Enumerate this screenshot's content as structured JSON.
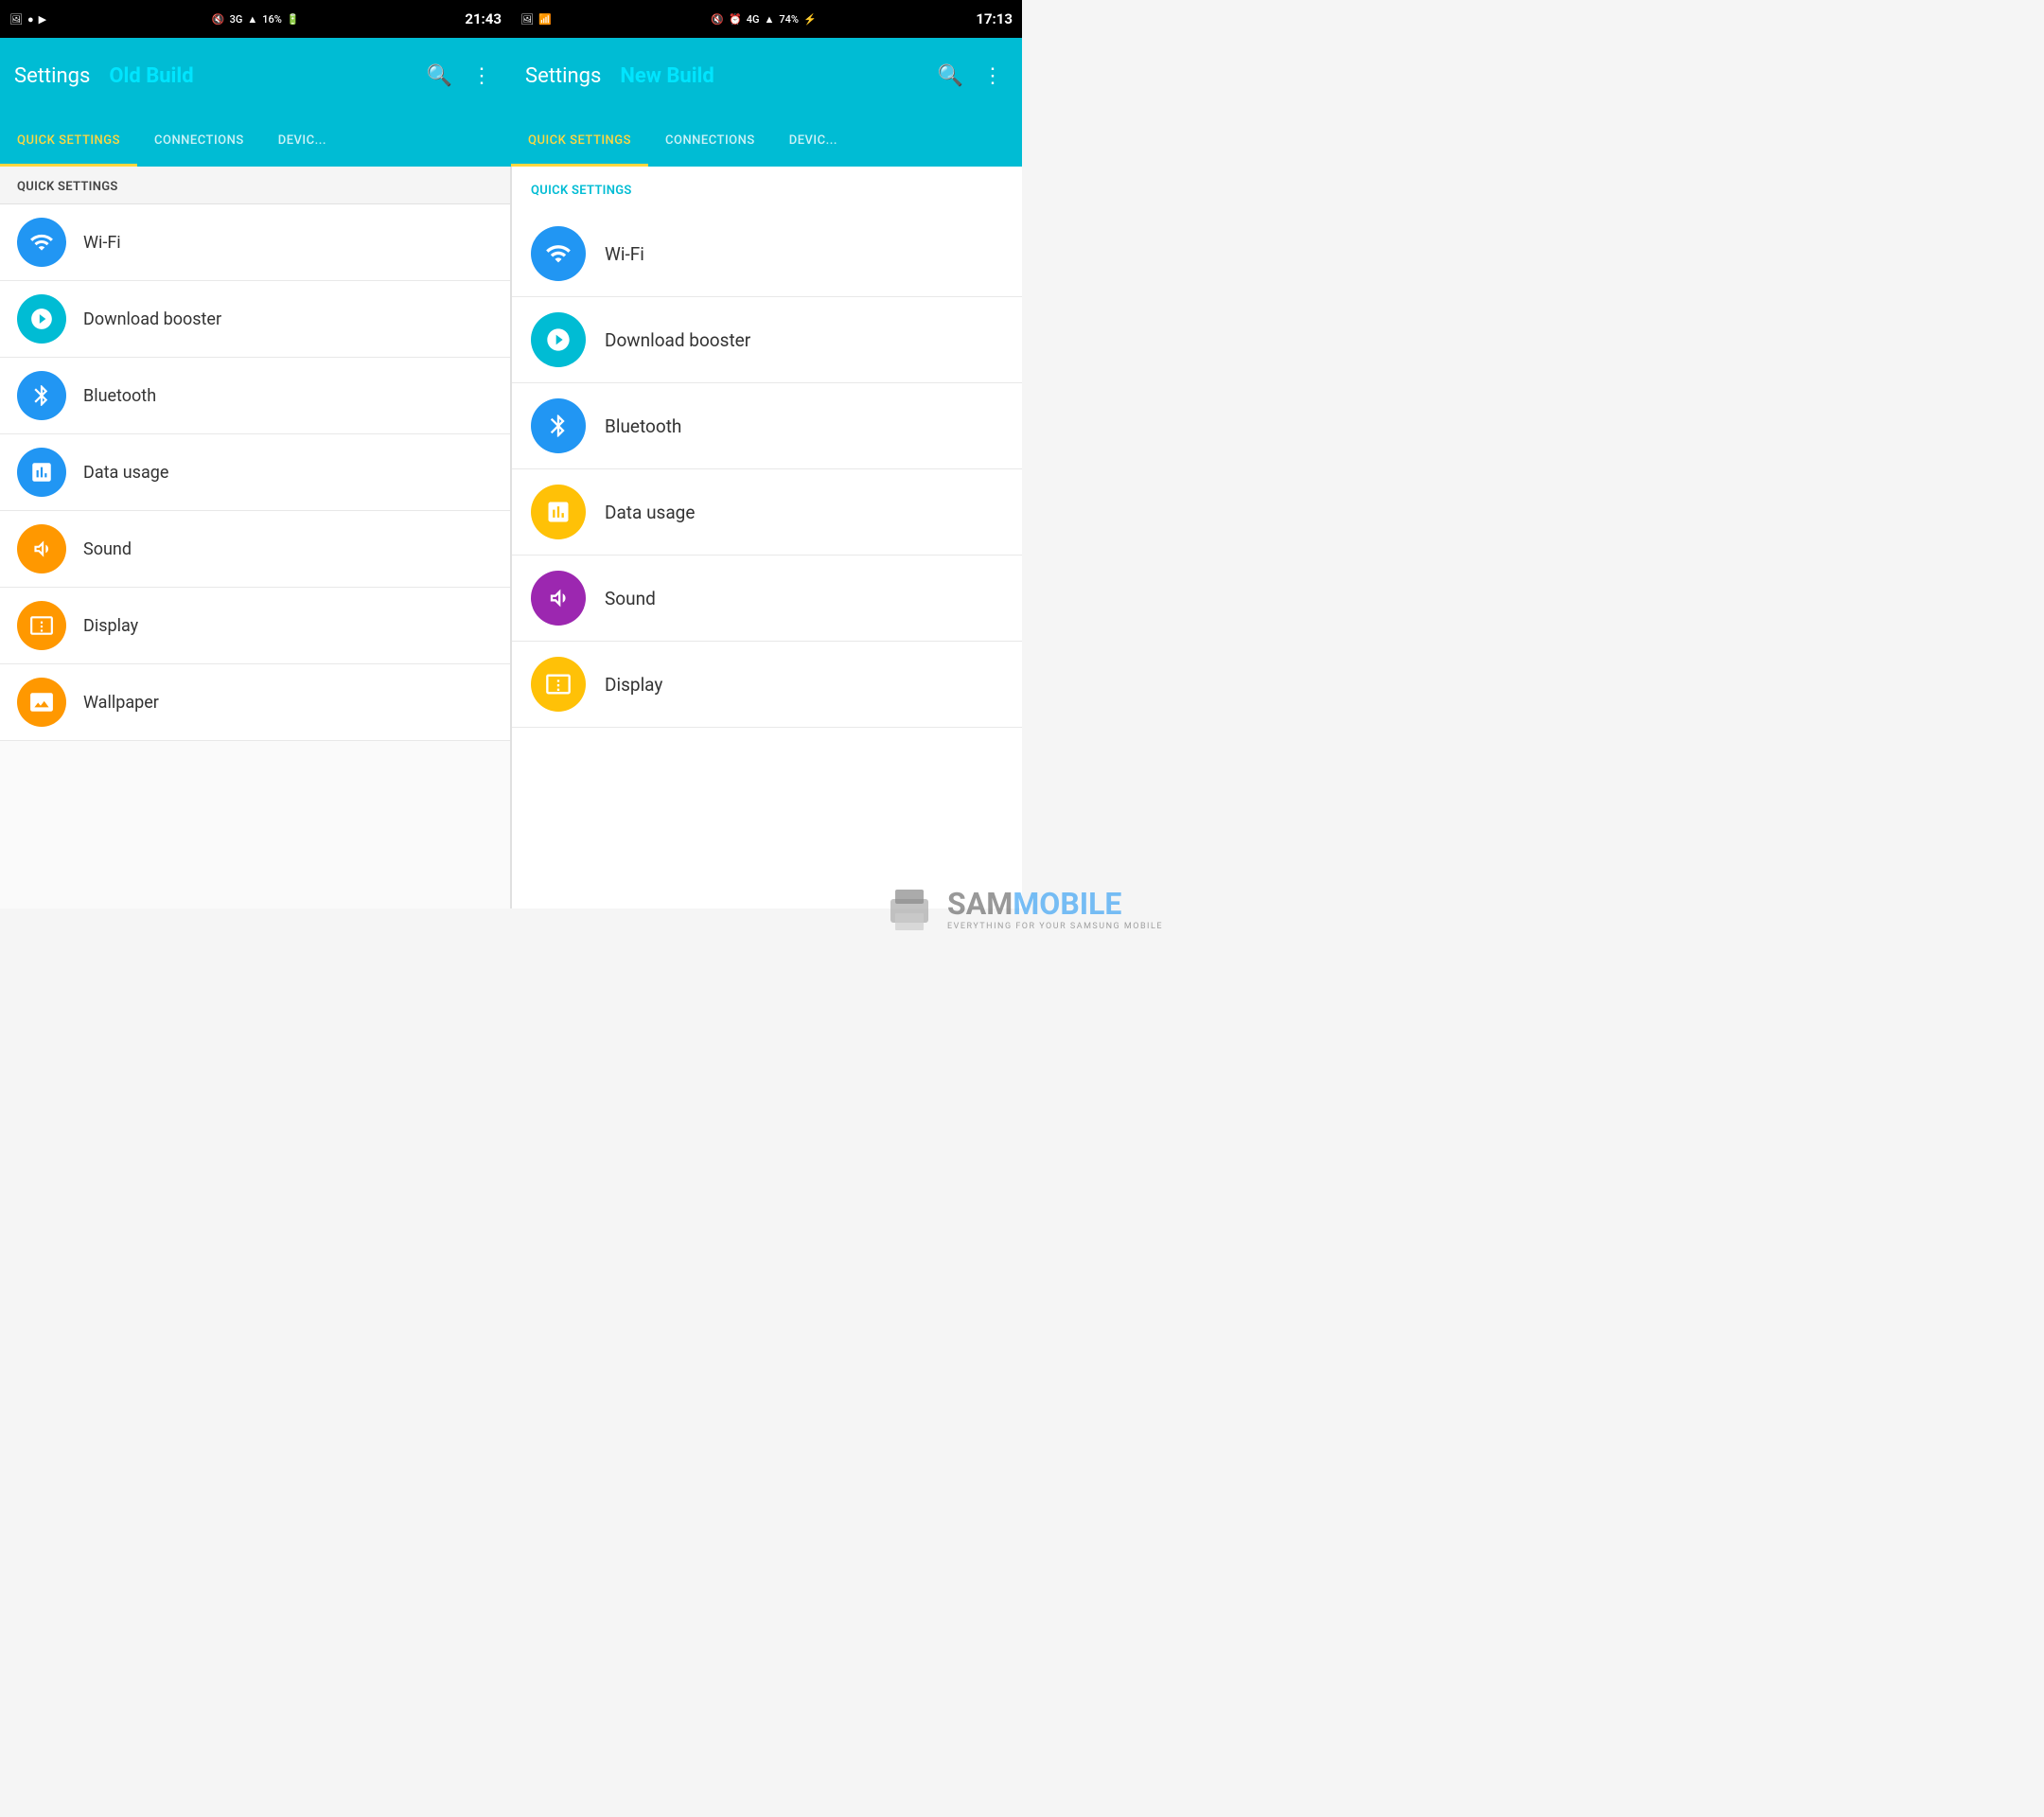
{
  "left": {
    "statusBar": {
      "time": "21:43",
      "battery": "16%",
      "network": "3G"
    },
    "header": {
      "title": "Settings",
      "build": "Old Build"
    },
    "tabs": [
      {
        "label": "QUICK SETTINGS",
        "active": true
      },
      {
        "label": "CONNECTIONS",
        "active": false
      },
      {
        "label": "DEVIC...",
        "active": false
      }
    ],
    "sectionHeader": "QUICK SETTINGS",
    "items": [
      {
        "label": "Wi-Fi",
        "iconColor": "icon-blue",
        "icon": "wifi"
      },
      {
        "label": "Download booster",
        "iconColor": "icon-cyan",
        "icon": "download-booster"
      },
      {
        "label": "Bluetooth",
        "iconColor": "icon-blue",
        "icon": "bluetooth"
      },
      {
        "label": "Data usage",
        "iconColor": "icon-blue",
        "icon": "data-usage"
      },
      {
        "label": "Sound",
        "iconColor": "icon-orange",
        "icon": "sound"
      },
      {
        "label": "Display",
        "iconColor": "icon-orange",
        "icon": "display"
      },
      {
        "label": "Wallpaper",
        "iconColor": "icon-orange",
        "icon": "wallpaper"
      }
    ]
  },
  "right": {
    "statusBar": {
      "time": "17:13",
      "battery": "74%",
      "network": "4G"
    },
    "header": {
      "title": "Settings",
      "build": "New Build"
    },
    "tabs": [
      {
        "label": "QUICK SETTINGS",
        "active": true
      },
      {
        "label": "CONNECTIONS",
        "active": false
      },
      {
        "label": "DEVIC...",
        "active": false
      }
    ],
    "sectionHeader": "QUICK SETTINGS",
    "items": [
      {
        "label": "Wi-Fi",
        "iconColor": "icon-blue",
        "icon": "wifi"
      },
      {
        "label": "Download booster",
        "iconColor": "icon-cyan",
        "icon": "download-booster"
      },
      {
        "label": "Bluetooth",
        "iconColor": "icon-blue",
        "icon": "bluetooth"
      },
      {
        "label": "Data usage",
        "iconColor": "icon-amber",
        "icon": "data-usage"
      },
      {
        "label": "Sound",
        "iconColor": "icon-purple",
        "icon": "sound"
      },
      {
        "label": "Display",
        "iconColor": "icon-amber",
        "icon": "display"
      }
    ]
  },
  "watermark": {
    "text1": "SAMM",
    "text2": "BILE",
    "sub": "EVERYTHING FOR YOUR SAMSUNG MOBILE"
  }
}
